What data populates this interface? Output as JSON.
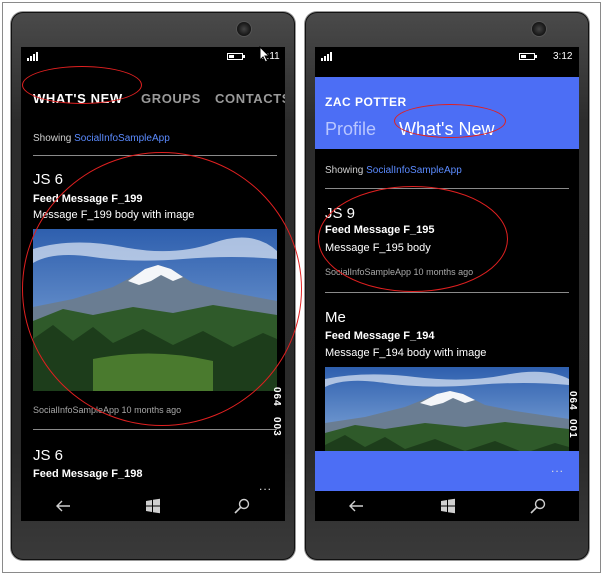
{
  "left_phone": {
    "status": {
      "clock": "3:11"
    },
    "pivot_tabs": [
      {
        "label": "WHAT'S NEW",
        "active": true
      },
      {
        "label": "GROUPS",
        "active": false
      },
      {
        "label": "CONTACTS",
        "active": false
      }
    ],
    "showing_label": "Showing",
    "showing_link": "SocialInfoSampleApp",
    "posts": [
      {
        "author": "JS 6",
        "title": "Feed Message F_199",
        "body": "Message F_199 body with image",
        "meta": "SocialInfoSampleApp 10 months ago"
      },
      {
        "author": "JS 6",
        "title": "Feed Message F_198"
      }
    ],
    "side_text": [
      "064",
      "003"
    ],
    "ellipsis": "..."
  },
  "right_phone": {
    "status": {
      "clock": "3:12"
    },
    "app_title": "ZAC POTTER",
    "header_tabs": [
      {
        "label": "Profile",
        "active": false
      },
      {
        "label": "What's New",
        "active": true
      }
    ],
    "showing_label": "Showing",
    "showing_link": "SocialInfoSampleApp",
    "posts": [
      {
        "author": "JS 9",
        "title": "Feed Message F_195",
        "body": "Message F_195 body",
        "meta": "SocialInfoSampleApp 10 months ago"
      },
      {
        "author": "Me",
        "title": "Feed Message F_194",
        "body": "Message F_194 body with image"
      }
    ],
    "side_text": [
      "064",
      "001"
    ],
    "ellipsis": "..."
  },
  "navbar_icons": [
    "back-arrow-icon",
    "windows-start-icon",
    "search-icon"
  ],
  "colors": {
    "accent": "#4c6ef5",
    "link": "#5b8bff",
    "annotation": "#e02020",
    "screen_bg": "#000000"
  }
}
